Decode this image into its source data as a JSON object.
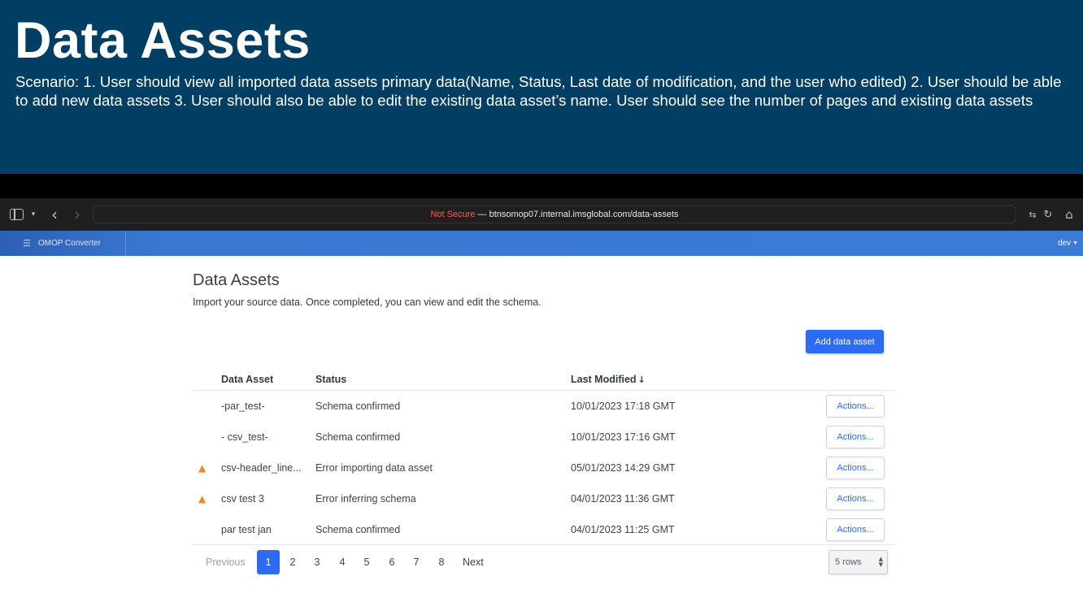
{
  "banner": {
    "title": "Data Assets",
    "description": "Scenario:  1. User should view all imported data assets primary data(Name, Status, Last date of modification, and the user who edited) 2. User should be able to add new data assets 3. User should also be able to edit the existing data asset’s name. User should see the number of pages and existing data assets"
  },
  "browser": {
    "url_warning": "Not Secure",
    "url_rest": " — btnsomop07.internal.imsglobal.com/data-assets",
    "icons": [
      "sidebar-icon",
      "chevron-down-icon",
      "back-icon",
      "forward-icon",
      "translate-icon",
      "reload-icon",
      "home-icon"
    ]
  },
  "navbar": {
    "brand": "OMOP Converter",
    "user": "dev",
    "accent_color": "#3b7bd6"
  },
  "page": {
    "title": "Data Assets",
    "subtitle": "Import your source data. Once completed, you can view and edit the schema.",
    "add_button": "Add data asset",
    "primary_color": "#2d6bf2",
    "warning_color": "#ee8b1f"
  },
  "table": {
    "columns": [
      "Data Asset",
      "Status",
      "Last Modified"
    ],
    "sort_indicator": "↓",
    "rows": [
      {
        "name": "-par_test-",
        "status": "Schema confirmed",
        "modified": "10/01/2023 17:18 GMT",
        "warning": false,
        "action": "Actions..."
      },
      {
        "name": "- csv_test-",
        "status": "Schema confirmed",
        "modified": "10/01/2023 17:16 GMT",
        "warning": false,
        "action": "Actions..."
      },
      {
        "name": "csv-header_line...",
        "status": "Error importing data asset",
        "modified": "05/01/2023 14:29 GMT",
        "warning": true,
        "action": "Actions..."
      },
      {
        "name": "csv test 3",
        "status": "Error inferring schema",
        "modified": "04/01/2023 11:36 GMT",
        "warning": true,
        "action": "Actions..."
      },
      {
        "name": "par test jan",
        "status": "Schema confirmed",
        "modified": "04/01/2023 11:25 GMT",
        "warning": false,
        "action": "Actions..."
      }
    ]
  },
  "pagination": {
    "previous": "Previous",
    "next": "Next",
    "pages": [
      "1",
      "2",
      "3",
      "4",
      "5",
      "6",
      "7",
      "8"
    ],
    "current": "1",
    "rows_per_page": "5 rows"
  }
}
